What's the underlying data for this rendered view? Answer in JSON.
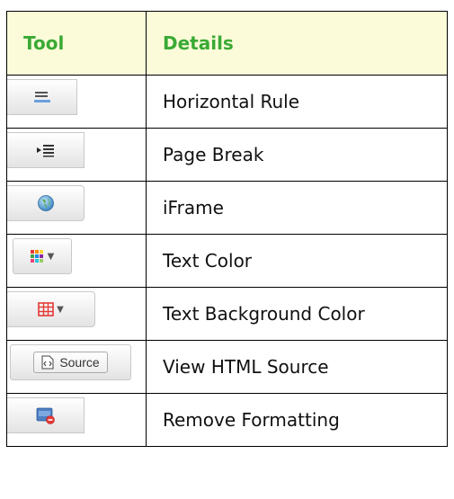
{
  "headers": {
    "tool": "Tool",
    "details": "Details"
  },
  "rows": [
    {
      "icon": "horizontal-rule-icon",
      "details": "Horizontal Rule"
    },
    {
      "icon": "page-break-icon",
      "details": "Page Break"
    },
    {
      "icon": "iframe-globe-icon",
      "details": "iFrame"
    },
    {
      "icon": "text-color-icon",
      "details": "Text Color"
    },
    {
      "icon": "text-background-color-icon",
      "details": "Text Background Color"
    },
    {
      "icon": "source-icon",
      "details": "View HTML Source",
      "button_label": "Source"
    },
    {
      "icon": "remove-formatting-icon",
      "details": "Remove Formatting"
    }
  ],
  "colors": {
    "header_text": "#3aaa35",
    "header_bg": "#fbfbd9"
  }
}
